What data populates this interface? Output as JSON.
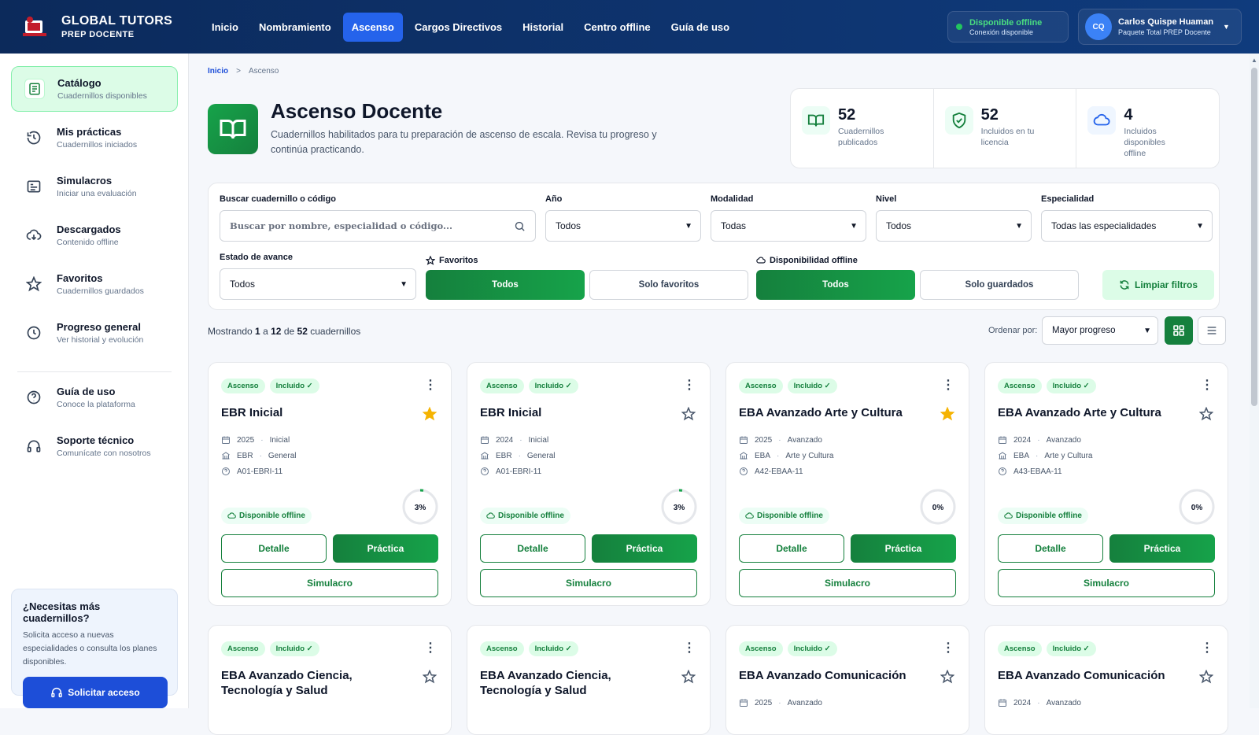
{
  "brand": {
    "name": "GLOBAL TUTORS",
    "sub": "PREP DOCENTE"
  },
  "nav": [
    "Inicio",
    "Nombramiento",
    "Ascenso",
    "Cargos Directivos",
    "Historial",
    "Centro offline",
    "Guía de uso"
  ],
  "nav_active": "Ascenso",
  "offline_status": {
    "title": "Disponible offline",
    "sub": "Conexión disponible"
  },
  "user": {
    "initials": "CQ",
    "name": "Carlos Quispe Huaman",
    "plan": "Paquete Total PREP Docente"
  },
  "sidebar": {
    "items": [
      {
        "label": "Catálogo",
        "sub": "Cuadernillos disponibles",
        "icon": "catalog-icon"
      },
      {
        "label": "Mis prácticas",
        "sub": "Cuadernillos iniciados",
        "icon": "history-icon"
      },
      {
        "label": "Simulacros",
        "sub": "Iniciar una evaluación",
        "icon": "exam-icon"
      },
      {
        "label": "Descargados",
        "sub": "Contenido offline",
        "icon": "cloud-download-icon"
      },
      {
        "label": "Favoritos",
        "sub": "Cuadernillos guardados",
        "icon": "star-icon"
      },
      {
        "label": "Progreso general",
        "sub": "Ver historial y evolución",
        "icon": "clock-icon"
      },
      {
        "label": "Guía de uso",
        "sub": "Conoce la plataforma",
        "icon": "help-icon"
      },
      {
        "label": "Soporte técnico",
        "sub": "Comunícate con nosotros",
        "icon": "headset-icon"
      }
    ],
    "help": {
      "title": "¿Necesitas más cuadernillos?",
      "text": "Solicita acceso a nuevas especialidades o consulta los planes disponibles.",
      "button": "Solicitar acceso"
    }
  },
  "breadcrumb": {
    "home": "Inicio",
    "sep": ">",
    "current": "Ascenso"
  },
  "hero": {
    "title": "Ascenso Docente",
    "subtitle": "Cuadernillos habilitados para tu preparación de ascenso de escala. Revisa tu progreso y continúa practicando."
  },
  "stats": [
    {
      "num": "52",
      "label": "Cuadernillos publicados"
    },
    {
      "num": "52",
      "label": "Incluidos en tu licencia"
    },
    {
      "num": "4",
      "label": "Incluidos disponibles offline"
    }
  ],
  "filters": {
    "search_label": "Buscar cuadernillo o código",
    "search_placeholder": "Buscar por nombre, especialidad o código...",
    "year_label": "Año",
    "year_value": "Todos",
    "modality_label": "Modalidad",
    "modality_value": "Todas",
    "level_label": "Nivel",
    "level_value": "Todos",
    "specialty_label": "Especialidad",
    "specialty_value": "Todas las especialidades",
    "status_label": "Estado de avance",
    "status_value": "Todos",
    "fav_label": "Favoritos",
    "fav_all": "Todos",
    "fav_only": "Solo favoritos",
    "offline_label": "Disponibilidad offline",
    "offline_all": "Todos",
    "offline_saved": "Solo guardados",
    "clear": "Limpiar filtros"
  },
  "results": {
    "prefix": "Mostrando",
    "from": "1",
    "a": "a",
    "to": "12",
    "de": "de",
    "total": "52",
    "suffix": "cuadernillos"
  },
  "order": {
    "label": "Ordenar por:",
    "value": "Mayor progreso"
  },
  "card_labels": {
    "badge1": "Ascenso",
    "badge2": "Incluido ✓",
    "offline": "Disponible offline",
    "detail": "Detalle",
    "practice": "Práctica",
    "sim": "Simulacro"
  },
  "cards": [
    {
      "title": "EBR Inicial",
      "year": "2025",
      "level": "Inicial",
      "modality": "EBR",
      "area": "General",
      "code": "A01-EBRI-11",
      "progress": 3,
      "progress_label": "3%",
      "favorite": true
    },
    {
      "title": "EBR Inicial",
      "year": "2024",
      "level": "Inicial",
      "modality": "EBR",
      "area": "General",
      "code": "A01-EBRI-11",
      "progress": 3,
      "progress_label": "3%",
      "favorite": false
    },
    {
      "title": "EBA Avanzado Arte y Cultura",
      "year": "2025",
      "level": "Avanzado",
      "modality": "EBA",
      "area": "Arte y Cultura",
      "code": "A42-EBAA-11",
      "progress": 0,
      "progress_label": "0%",
      "favorite": true
    },
    {
      "title": "EBA Avanzado Arte y Cultura",
      "year": "2024",
      "level": "Avanzado",
      "modality": "EBA",
      "area": "Arte y Cultura",
      "code": "A43-EBAA-11",
      "progress": 0,
      "progress_label": "0%",
      "favorite": false
    },
    {
      "title": "EBA Avanzado Ciencia, Tecnología y Salud",
      "favorite": false
    },
    {
      "title": "EBA Avanzado Ciencia, Tecnología y Salud",
      "favorite": false
    },
    {
      "title": "EBA Avanzado Comunicación",
      "year": "2025",
      "level": "Avanzado",
      "favorite": false
    },
    {
      "title": "EBA Avanzado Comunicación",
      "year": "2024",
      "level": "Avanzado",
      "favorite": false
    }
  ],
  "colors": {
    "primary_green": "#15803d",
    "nav_blue": "#0c2a5b",
    "accent_blue": "#2563eb",
    "star": "#f5b301"
  }
}
